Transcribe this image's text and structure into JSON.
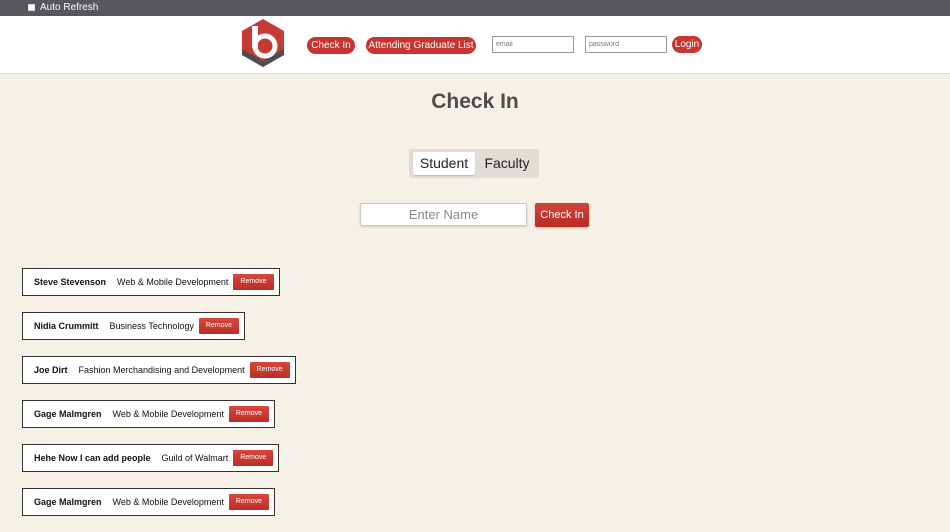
{
  "topbar": {
    "auto_refresh_label": "Auto Refresh"
  },
  "header": {
    "logo_icon": "hexagon-b-logo-icon",
    "checkin_link": "Check In",
    "attending_link": "Attending Graduate List",
    "email_placeholder": "email",
    "password_placeholder": "password",
    "login_label": "Login"
  },
  "main": {
    "title": "Check In",
    "toggle": {
      "student_label": "Student",
      "faculty_label": "Faculty",
      "selected": "Student"
    },
    "name_placeholder": "Enter Name",
    "checkin_button": "Check In"
  },
  "attendees": [
    {
      "name": "Steve Stevenson",
      "program": "Web & Mobile Development",
      "remove": "Remove"
    },
    {
      "name": "Nidia Crummitt",
      "program": "Business Technology",
      "remove": "Remove"
    },
    {
      "name": "Joe Dirt",
      "program": "Fashion Merchandising and Development",
      "remove": "Remove"
    },
    {
      "name": "Gage Malmgren",
      "program": "Web & Mobile Development",
      "remove": "Remove"
    },
    {
      "name": "Hehe Now I can add people",
      "program": "Guild of Walmart",
      "remove": "Remove"
    },
    {
      "name": "Gage Malmgren",
      "program": "Web & Mobile Development",
      "remove": "Remove"
    }
  ],
  "colors": {
    "accent": "#c8342f",
    "background": "#f6f1e6",
    "topbar": "#57565b"
  }
}
